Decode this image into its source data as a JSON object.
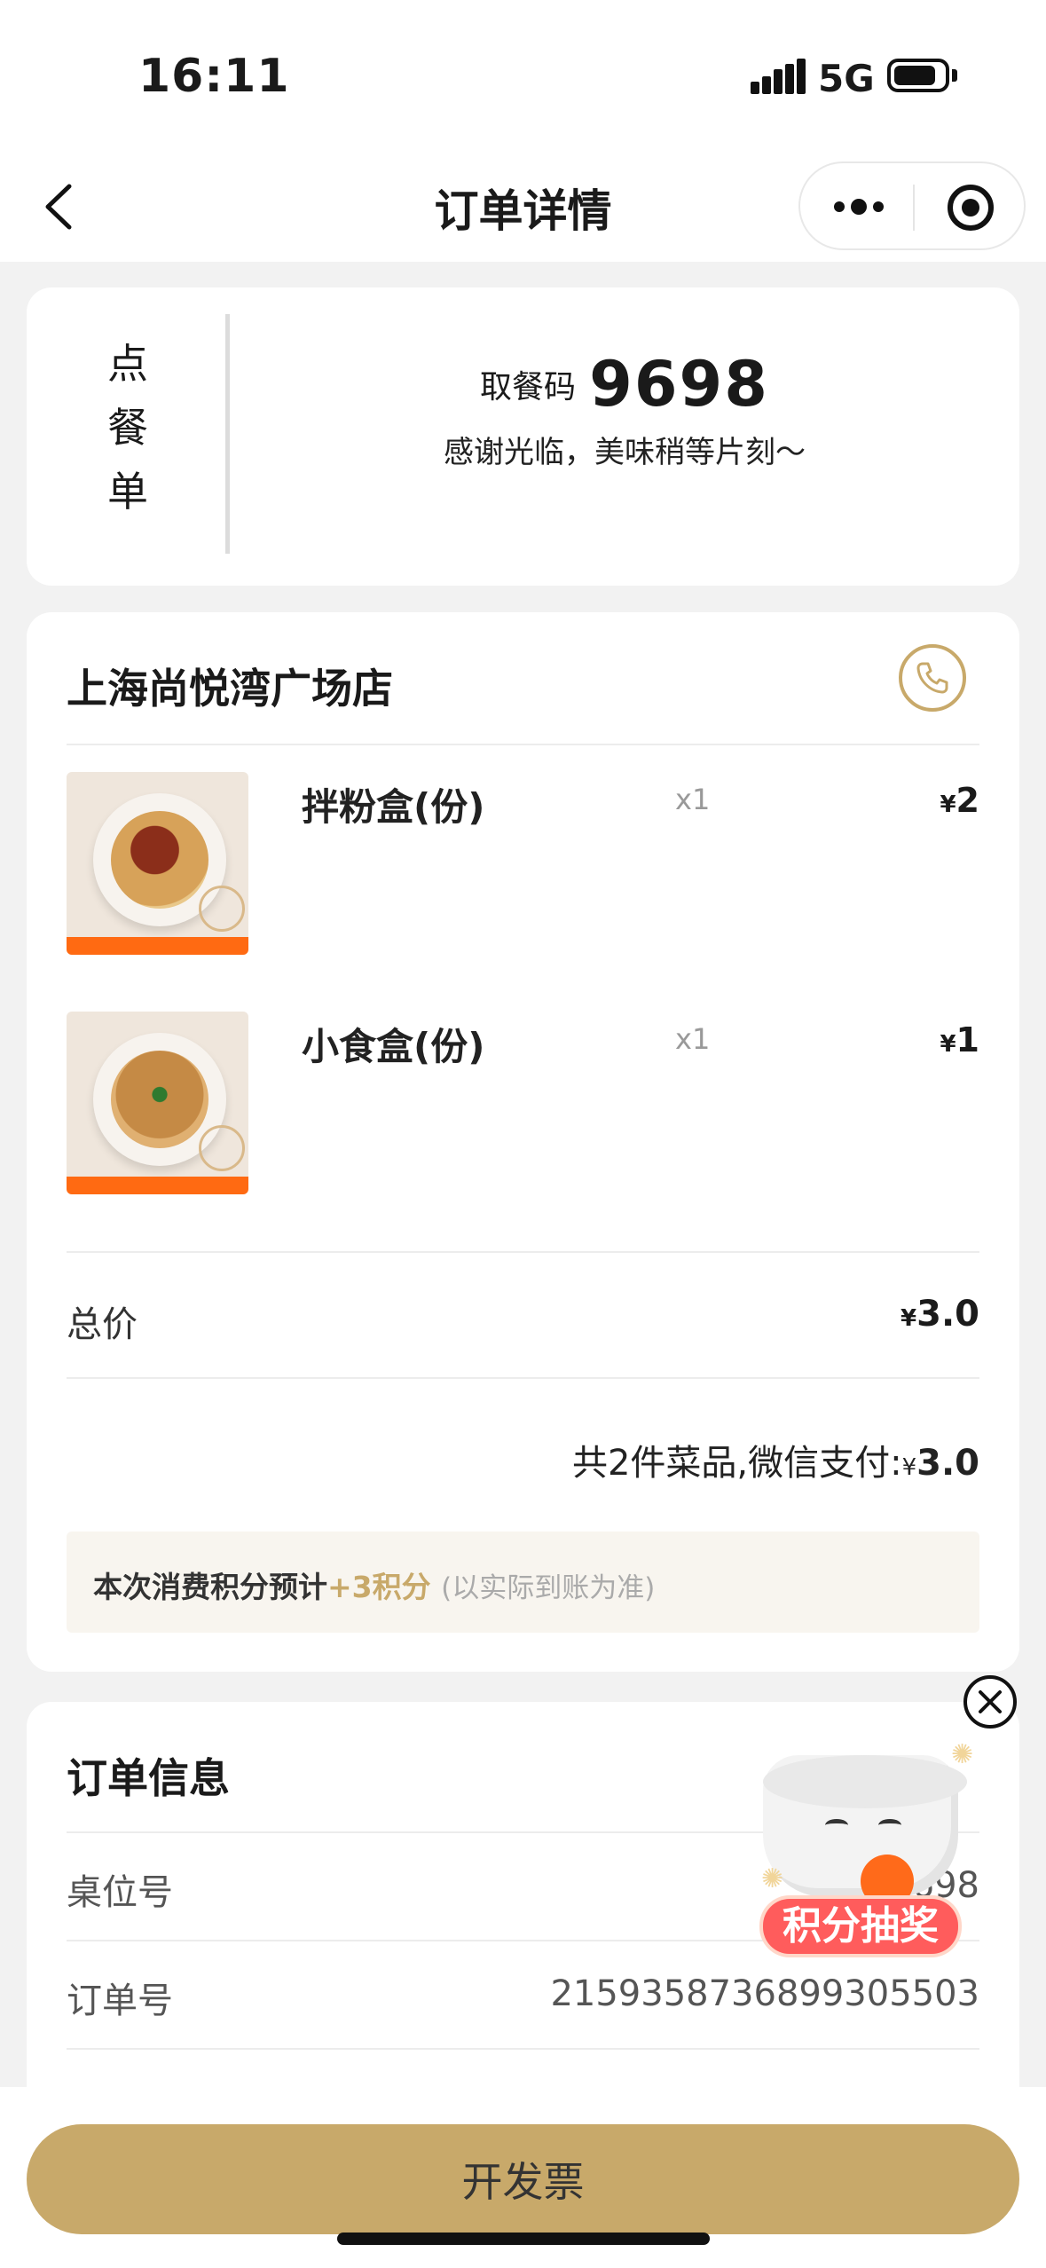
{
  "status_bar": {
    "time": "16:11",
    "network": "5G"
  },
  "nav": {
    "title": "订单详情"
  },
  "pickup": {
    "tag_chars": [
      "点",
      "餐",
      "单"
    ],
    "code_label": "取餐码",
    "code": "9698",
    "note": "感谢光临，美味稍等片刻～"
  },
  "store": {
    "name": "上海尚悦湾广场店"
  },
  "items": [
    {
      "name": "拌粉盒(份)",
      "qty": "x1",
      "currency": "¥",
      "price": "2"
    },
    {
      "name": "小食盒(份)",
      "qty": "x1",
      "currency": "¥",
      "price": "1"
    }
  ],
  "total": {
    "label": "总价",
    "currency": "¥",
    "value": "3.0"
  },
  "summary": {
    "text": "共2件菜品,微信支付:",
    "currency": "¥",
    "value": "3.0"
  },
  "points": {
    "prefix": "本次消费积分预计",
    "amount": "+3积分",
    "note": "(以实际到账为准)"
  },
  "order_info": {
    "title": "订单信息",
    "rows": [
      {
        "label": "桌位号",
        "value": "9698"
      },
      {
        "label": "订单号",
        "value": "2159358736899305503"
      }
    ]
  },
  "lottery": {
    "label": "积分抽奖"
  },
  "bottom": {
    "invoice_label": "开发票"
  },
  "colors": {
    "accent": "#c8a96a",
    "orange": "#ff6a12",
    "lottery_red": "#ff5c5c"
  }
}
